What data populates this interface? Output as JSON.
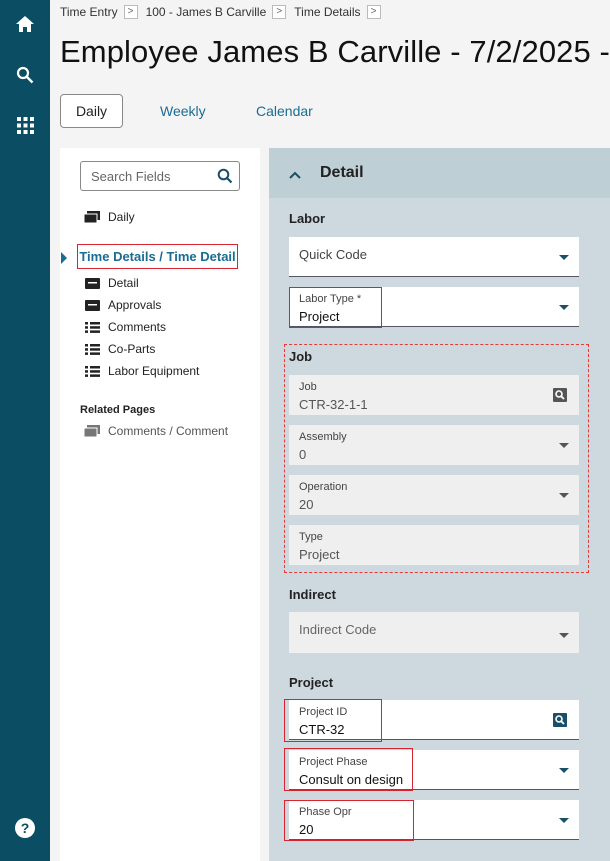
{
  "breadcrumbs": [
    "Time Entry",
    "100 - James B Carville",
    "Time Details"
  ],
  "breadcrumb_sep": ">",
  "title": "Employee James B Carville - 7/2/2025 -",
  "tabs": {
    "daily": "Daily",
    "weekly": "Weekly",
    "calendar": "Calendar"
  },
  "search": {
    "placeholder": "Search Fields"
  },
  "nav": {
    "daily": "Daily",
    "active": "Time Details / Time Detail",
    "children": [
      "Detail",
      "Approvals",
      "Comments",
      "Co-Parts",
      "Labor Equipment"
    ],
    "related_heading": "Related Pages",
    "related": [
      "Comments / Comment"
    ]
  },
  "detail": {
    "title": "Detail",
    "labor": {
      "heading": "Labor",
      "quick_code": "Quick Code",
      "labor_type_label": "Labor Type *",
      "labor_type_value": "Project"
    },
    "job": {
      "heading": "Job",
      "job_label": "Job",
      "job_value": "CTR-32-1-1",
      "assembly_label": "Assembly",
      "assembly_value": "0",
      "operation_label": "Operation",
      "operation_value": "20",
      "type_label": "Type",
      "type_value": "Project"
    },
    "indirect": {
      "heading": "Indirect",
      "indirect_code": "Indirect Code"
    },
    "project": {
      "heading": "Project",
      "project_id_label": "Project ID",
      "project_id_value": "CTR-32",
      "phase_label": "Project Phase",
      "phase_value": "Consult on design",
      "phase_opr_label": "Phase Opr",
      "phase_opr_value": "20"
    }
  },
  "icons": {
    "rail": [
      "home-icon",
      "search-icon",
      "apps-grid-icon",
      "help-icon"
    ]
  },
  "help_glyph": "?",
  "colors": {
    "rail": "#0b4d63",
    "accent": "#1a6c93",
    "highlight": "#d9232e",
    "panel": "#cdd9de"
  }
}
